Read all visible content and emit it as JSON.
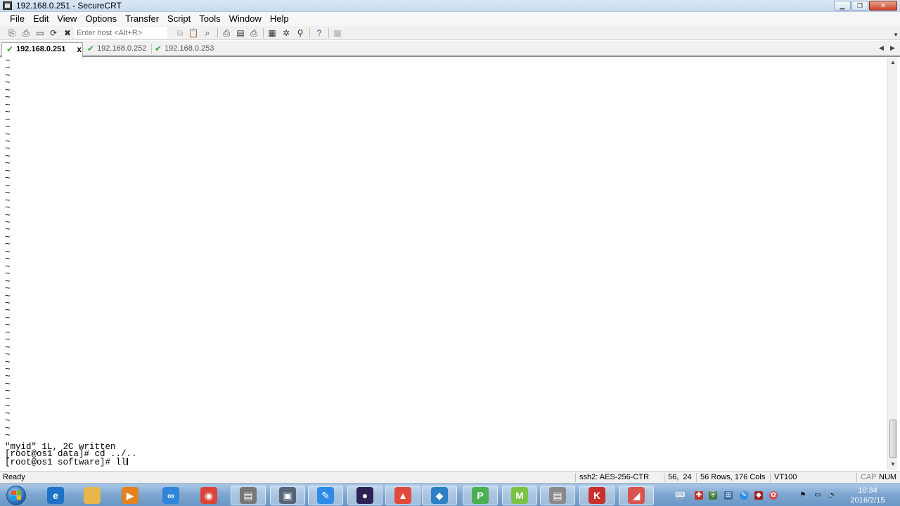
{
  "window": {
    "title": "192.168.0.251 - SecureCRT"
  },
  "menu": [
    "File",
    "Edit",
    "View",
    "Options",
    "Transfer",
    "Script",
    "Tools",
    "Window",
    "Help"
  ],
  "toolbar": {
    "host_placeholder": "Enter host <Alt+R>"
  },
  "tabs": [
    {
      "label": "192.168.0.251",
      "active": true,
      "close": "x"
    },
    {
      "label": "192.168.0.252",
      "active": false
    },
    {
      "label": "192.168.0.253",
      "active": false
    }
  ],
  "terminal": {
    "tilde_line": "~",
    "lines": [
      "\"myid\" 1L, 2C written",
      "[root@os1 data]# cd ../..",
      "[root@os1 software]# ll"
    ]
  },
  "statusbar": {
    "ready": "Ready",
    "cipher": "ssh2: AES-256-CTR",
    "cursor_pos": "56,  24",
    "size": "56 Rows, 176 Cols",
    "emulation": "VT100",
    "caps": "CAP",
    "num": "NUM"
  },
  "taskbar": {
    "apps": [
      {
        "name": "internet-explorer",
        "color": "#1e73c8",
        "glyph": "e"
      },
      {
        "name": "file-explorer",
        "color": "#e8b64a",
        "glyph": ""
      },
      {
        "name": "media-player",
        "color": "#e3821f",
        "glyph": "▶"
      },
      {
        "name": "baidu-cloud",
        "color": "#2f86d8",
        "glyph": "∞"
      },
      {
        "name": "chrome",
        "color": "#db4437",
        "glyph": "◉"
      },
      {
        "name": "securecrt-1",
        "color": "#777777",
        "glyph": "▤"
      },
      {
        "name": "securefx",
        "color": "#556677",
        "glyph": "▣"
      },
      {
        "name": "note-app",
        "color": "#2e8ce6",
        "glyph": "✎"
      },
      {
        "name": "eclipse",
        "color": "#2c2255",
        "glyph": "●"
      },
      {
        "name": "folder-tool",
        "color": "#e04a3a",
        "glyph": "▲"
      },
      {
        "name": "virtualbox",
        "color": "#2f7fc6",
        "glyph": "◆"
      },
      {
        "name": "pycharm",
        "color": "#4caf50",
        "glyph": "P"
      },
      {
        "name": "mindmap",
        "color": "#7cc242",
        "glyph": "M"
      },
      {
        "name": "securecrt-2",
        "color": "#8a8a8a",
        "glyph": "▤"
      },
      {
        "name": "pdf-reader",
        "color": "#c8302b",
        "glyph": "K"
      },
      {
        "name": "eraser-tool",
        "color": "#d9534f",
        "glyph": "◢"
      }
    ],
    "clock_time": "10:34",
    "clock_date": "2016/2/15"
  }
}
